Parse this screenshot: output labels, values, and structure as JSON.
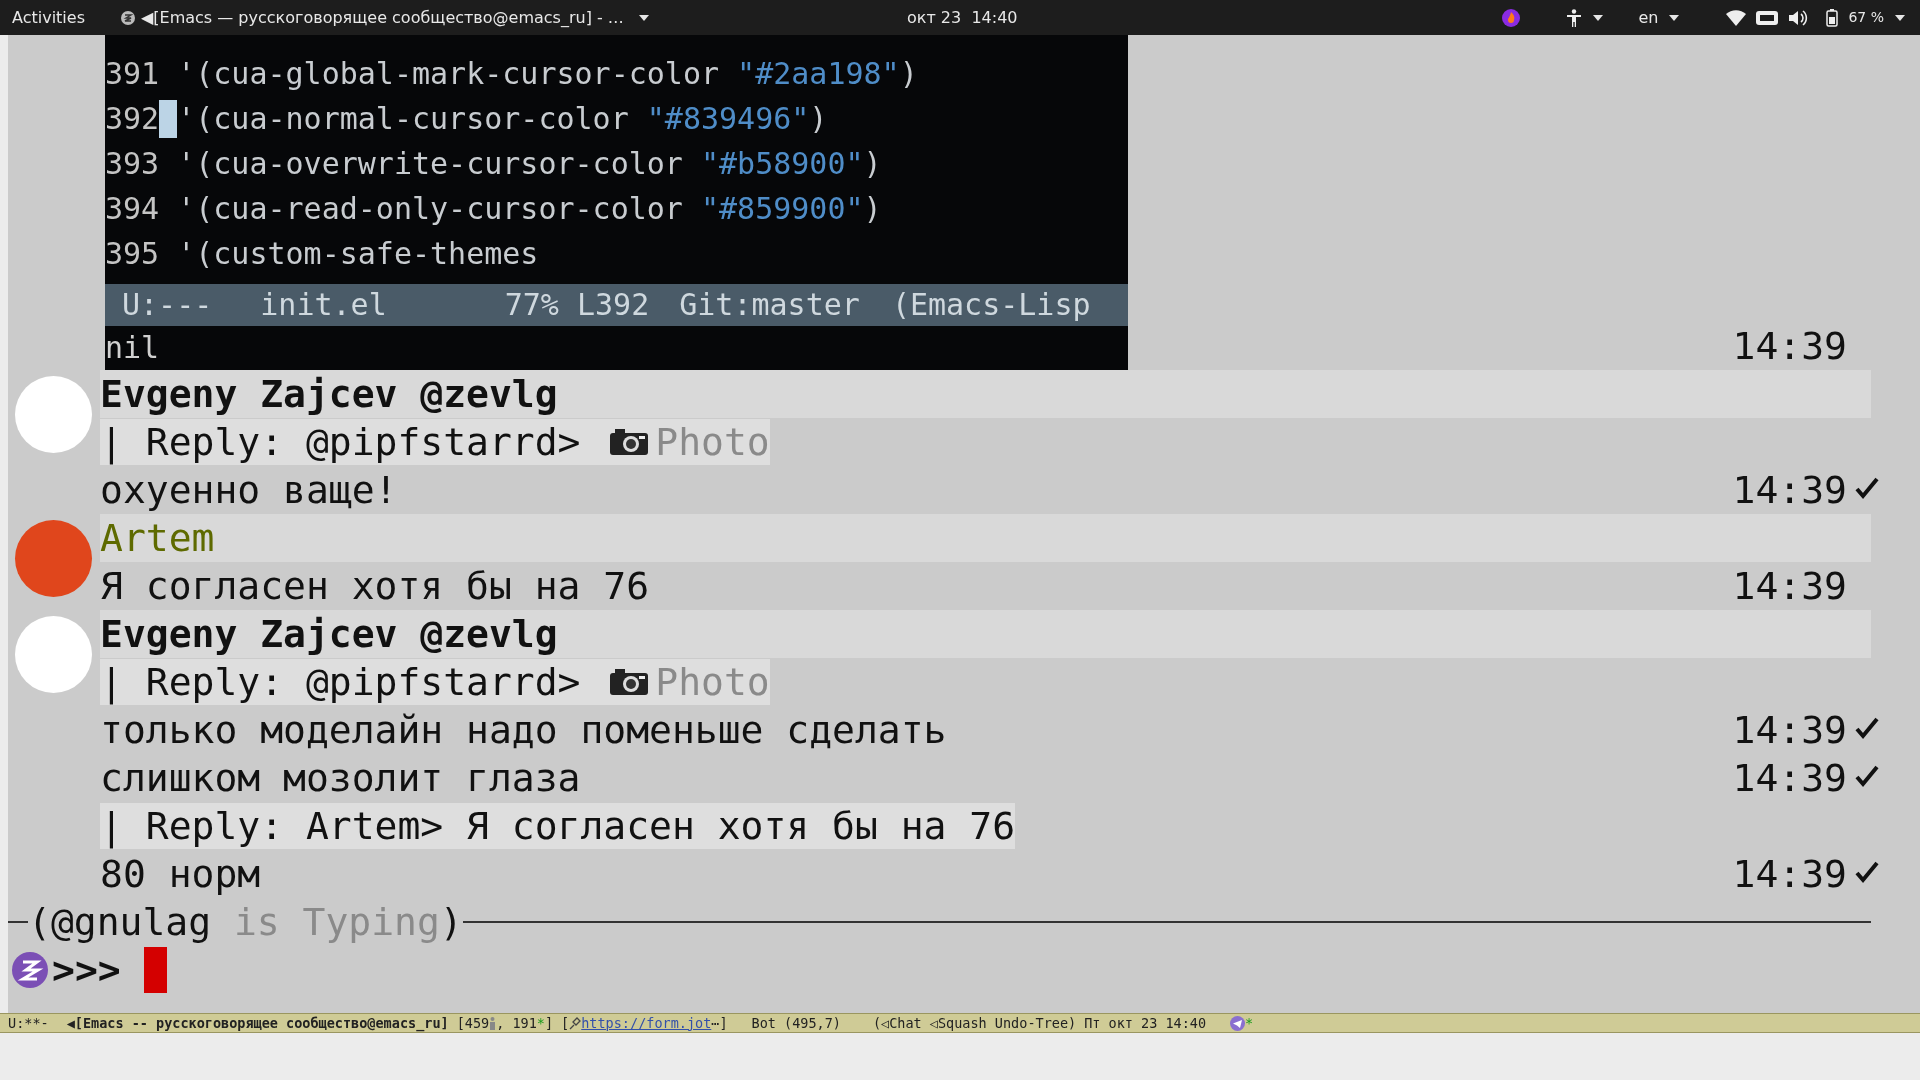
{
  "top_bar": {
    "activities": "Activities",
    "app_title": "◀[Emacs — русскоговорящее сообщество@emacs_ru] - …",
    "clock": "окт 23  14:40",
    "language": "en",
    "battery": "67 %"
  },
  "photo_message": {
    "time": "14:39",
    "editor": {
      "lines": [
        {
          "number": "391",
          "code": "'(cua-global-mark-cursor-color ",
          "string": "\"#2aa198\"",
          "close": ")",
          "cursor": false
        },
        {
          "number": "392",
          "code": "'(cua-normal-cursor-color ",
          "string": "\"#839496\"",
          "close": ")",
          "cursor": true
        },
        {
          "number": "393",
          "code": "'(cua-overwrite-cursor-color ",
          "string": "\"#b58900\"",
          "close": ")",
          "cursor": false
        },
        {
          "number": "394",
          "code": "'(cua-read-only-cursor-color ",
          "string": "\"#859900\"",
          "close": ")",
          "cursor": false
        },
        {
          "number": "395",
          "code": "'(custom-safe-themes",
          "cursor": false
        }
      ],
      "mode_line": [
        "U:---",
        "init.el",
        "77% L392",
        "Git:master",
        "(Emacs-Lisp"
      ],
      "echo": "nil"
    }
  },
  "messages": [
    {
      "sender": "Evgeny Zajcev @zevlg",
      "sender_bold": true,
      "avatar": {
        "color": "#ffffff"
      },
      "lines": [
        {
          "kind": "reply",
          "text": "| Reply: @pipfstarrd> ",
          "media": "Photo"
        },
        {
          "kind": "text",
          "text": "охуенно ваще!",
          "time": "14:39",
          "sent": true
        }
      ]
    },
    {
      "sender": "Artem",
      "sender_bold": false,
      "avatar": {
        "color": "#e0461c"
      },
      "lines": [
        {
          "kind": "text",
          "text": "Я согласен хотя бы на 76",
          "time": "14:39",
          "sent": false
        }
      ]
    },
    {
      "sender": "Evgeny Zajcev @zevlg",
      "sender_bold": true,
      "avatar": {
        "color": "#ffffff"
      },
      "lines": [
        {
          "kind": "reply",
          "text": "| Reply: @pipfstarrd> ",
          "media": "Photo"
        },
        {
          "kind": "text",
          "text": "только моделайн надо поменьше сделать",
          "time": "14:39",
          "sent": true
        },
        {
          "kind": "text",
          "text": "слишком мозолит глаза",
          "time": "14:39",
          "sent": true
        },
        {
          "kind": "reply",
          "text": "| Reply: Artem> Я согласен хотя бы на 76"
        },
        {
          "kind": "text",
          "text": "80 норм",
          "time": "14:39",
          "sent": true
        }
      ]
    }
  ],
  "typing": {
    "user": "(@gnulag",
    "status": " is Typing",
    "close": ")"
  },
  "prompt": ">>>",
  "mode_line": {
    "status": "U:**-",
    "buffer": "◀[Emacs -- русскоговорящее сообщество@emacs_ru]",
    "counts_open": "[459",
    "counts_mid": ", 191",
    "unread_mark": "*",
    "counts_close": "]",
    "link_open": "[",
    "link": "https://form.jot",
    "link_close": "⋯]",
    "position": "Bot (495,7)",
    "modes": "(◁Chat ◁Squash Undo-Tree)",
    "datetime": "Пт окт 23 14:40",
    "telegram_mark": "*"
  }
}
